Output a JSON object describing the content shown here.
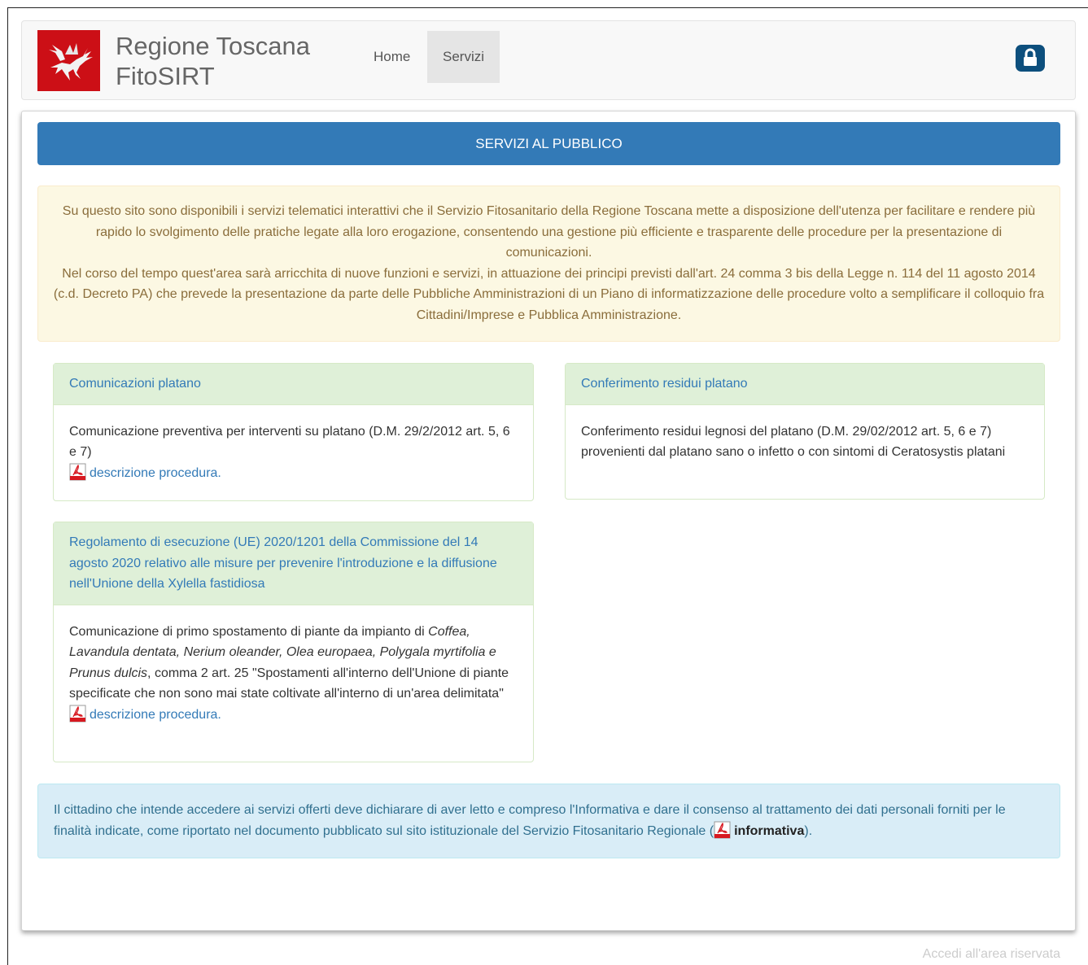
{
  "header": {
    "logo_alt": "Regione Toscana logo",
    "brand_line1": "Regione Toscana",
    "brand_line2": "FitoSIRT",
    "nav": [
      "Home",
      "Servizi"
    ],
    "lock_icon": "lock-icon"
  },
  "main": {
    "title": "SERVIZI AL PUBBLICO",
    "intro_p1": "Su questo sito sono disponibili i servizi telematici interattivi che il Servizio Fitosanitario della Regione Toscana mette a disposizione dell'utenza per facilitare e rendere più rapido lo svolgimento delle pratiche legate alla loro erogazione, consentendo una gestione più efficiente e trasparente delle procedure per la presentazione di comunicazioni.",
    "intro_p2": "Nel corso del tempo quest'area sarà arricchita di nuove funzioni e servizi, in attuazione dei principi previsti dall'art. 24 comma 3 bis della Legge n. 114 del 11 agosto 2014 (c.d. Decreto PA) che prevede la presentazione da parte delle Pubbliche Amministrazioni di un Piano di informatizzazione delle procedure volto a semplificare il colloquio fra Cittadini/Imprese e Pubblica Amministrazione.",
    "cards": [
      {
        "title": "Comunicazioni platano",
        "body": "Comunicazione preventiva per interventi su platano (D.M. 29/2/2012 art. 5, 6 e 7)",
        "link": "descrizione procedura"
      },
      {
        "title": "Conferimento residui platano",
        "body": "Conferimento residui legnosi del platano (D.M. 29/02/2012 art. 5, 6 e 7) provenienti dal platano sano o infetto o con sintomi di Ceratosystis platani"
      },
      {
        "title": "Regolamento di esecuzione (UE) 2020/1201 della Commissione del 14 agosto 2020 relativo alle misure per prevenire l'introduzione e la diffusione nell'Unione della Xylella fastidiosa",
        "body_prefix": "Comunicazione di primo spostamento di piante da impianto di ",
        "body_italic": "Coffea, Lavandula dentata, Nerium oleander, Olea europaea, Polygala myrtifolia e Prunus dulcis",
        "body_suffix": ", comma 2 art. 25 \"Spostamenti all'interno dell'Unione di piante specificate che non sono mai state coltivate all'interno di un'area delimitata\"",
        "link": "descrizione procedura"
      }
    ],
    "notice_text": "Il cittadino che intende accedere ai servizi offerti deve dichiarare di aver letto e compreso l'Informativa e dare il consenso al trattamento dei dati personali forniti per le finalità indicate, come riportato nel documento pubblicato sul sito istituzionale del Servizio Fitosanitario Regionale (",
    "notice_link": "informativa",
    "notice_end": ")."
  },
  "footer": {
    "link": "Accedi all'area riservata"
  },
  "colors": {
    "primary": "#337ab7",
    "logo_red": "#cc0f16",
    "lock_bg": "#0d4f7d",
    "warning_bg": "#fcf8e3",
    "success_bg": "#dff0d8",
    "info_bg": "#d9edf7"
  }
}
